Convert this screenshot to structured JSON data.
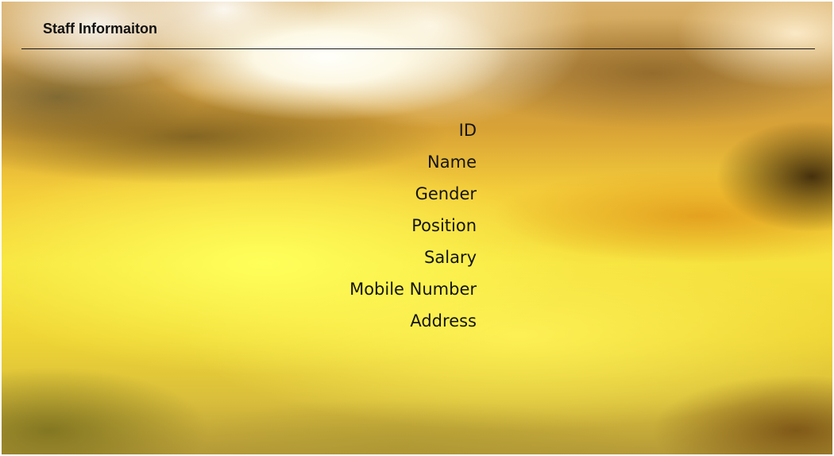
{
  "header": {
    "title": "Staff Informaiton"
  },
  "form": {
    "fields": [
      {
        "label": "ID"
      },
      {
        "label": "Name"
      },
      {
        "label": "Gender"
      },
      {
        "label": "Position"
      },
      {
        "label": "Salary"
      },
      {
        "label": "Mobile Number"
      },
      {
        "label": "Address"
      }
    ]
  }
}
